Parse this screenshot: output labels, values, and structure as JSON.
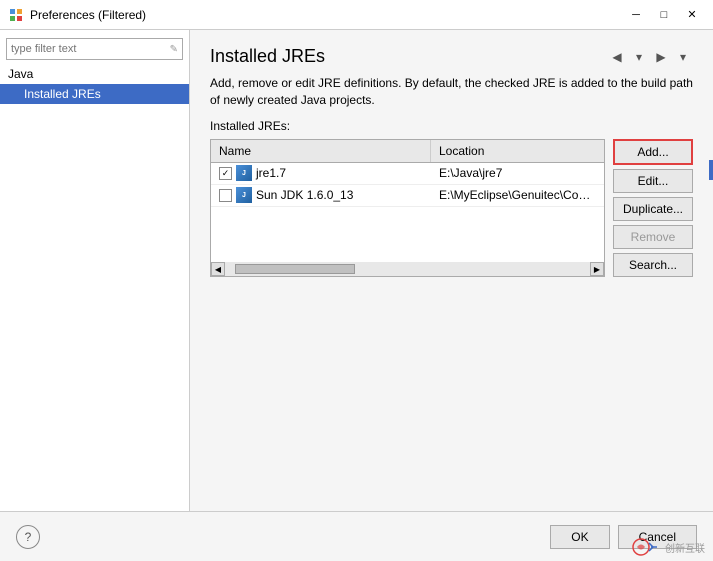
{
  "window": {
    "title": "Preferences (Filtered)",
    "icon": "⚙"
  },
  "titlebar": {
    "minimize_label": "─",
    "maximize_label": "□",
    "close_label": "✕"
  },
  "sidebar": {
    "filter_placeholder": "type filter text",
    "category": "Java",
    "selected_item": "Installed JREs"
  },
  "content": {
    "title": "Installed JREs",
    "description": "Add, remove or edit JRE definitions. By default, the checked JRE is added to the build path of newly created Java projects.",
    "section_label": "Installed JREs:",
    "table": {
      "columns": [
        "Name",
        "Location"
      ],
      "rows": [
        {
          "checked": true,
          "name": "jre1.7",
          "location": "E:\\Java\\jre7"
        },
        {
          "checked": false,
          "name": "Sun JDK 1.6.0_13",
          "location": "E:\\MyEclipse\\Genuitec\\Common\\binar"
        }
      ]
    },
    "buttons": {
      "add": "Add...",
      "edit": "Edit...",
      "duplicate": "Duplicate...",
      "remove": "Remove",
      "search": "Search..."
    }
  },
  "bottom": {
    "help_label": "?",
    "ok_label": "OK",
    "cancel_label": "Cancel",
    "watermark": "创新互联"
  },
  "nav": {
    "back_arrow": "◀",
    "back_dropdown": "▾",
    "forward_arrow": "▶",
    "forward_dropdown": "▾"
  }
}
